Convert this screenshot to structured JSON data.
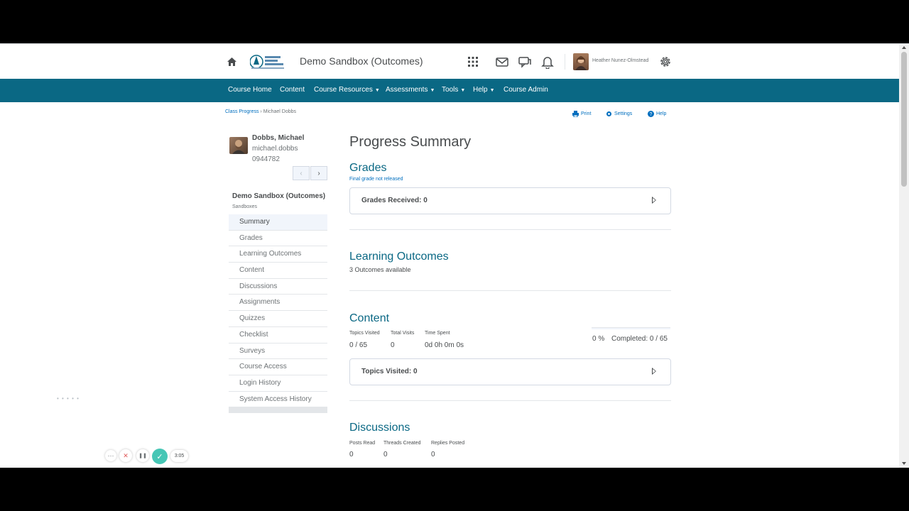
{
  "header": {
    "course_title": "Demo Sandbox (Outcomes)",
    "user_name": "Heather Nunez-Olmstead",
    "icons": [
      "home-icon",
      "waffle-icon",
      "mail-icon",
      "chat-icon",
      "bell-icon",
      "gear-icon"
    ]
  },
  "nav": {
    "items": [
      {
        "label": "Course Home",
        "caret": false
      },
      {
        "label": "Content",
        "caret": false
      },
      {
        "label": "Course Resources",
        "caret": true
      },
      {
        "label": "Assessments",
        "caret": true
      },
      {
        "label": "Tools",
        "caret": true
      },
      {
        "label": "Help",
        "caret": true
      },
      {
        "label": "Course Admin",
        "caret": false
      }
    ]
  },
  "breadcrumb": {
    "parent": "Class Progress",
    "separator": "›",
    "current": "Michael Dobbs"
  },
  "actions": {
    "print": "Print",
    "settings": "Settings",
    "help": "Help"
  },
  "student": {
    "name": "Dobbs, Michael",
    "username": "michael.dobbs",
    "id": "0944782",
    "prev": "‹",
    "next": "›"
  },
  "sidebar": {
    "course": "Demo Sandbox (Outcomes)",
    "subtitle": "Sandboxes",
    "items": [
      {
        "label": "Summary"
      },
      {
        "label": "Grades"
      },
      {
        "label": "Learning Outcomes"
      },
      {
        "label": "Content"
      },
      {
        "label": "Discussions"
      },
      {
        "label": "Assignments"
      },
      {
        "label": "Quizzes"
      },
      {
        "label": "Checklist"
      },
      {
        "label": "Surveys"
      },
      {
        "label": "Course Access"
      },
      {
        "label": "Login History"
      },
      {
        "label": "System Access History"
      }
    ]
  },
  "main": {
    "title": "Progress Summary",
    "grades": {
      "title": "Grades",
      "note": "Final grade not released",
      "panel": "Grades Received: 0"
    },
    "outcomes": {
      "title": "Learning Outcomes",
      "text": "3 Outcomes available"
    },
    "content": {
      "title": "Content",
      "topics_visited_label": "Topics Visited",
      "topics_visited_value": "0 / 65",
      "total_visits_label": "Total Visits",
      "total_visits_value": "0",
      "time_spent_label": "Time Spent",
      "time_spent_value": "0d 0h 0m 0s",
      "percent": "0 %",
      "completed_label": "Completed:",
      "completed_value": "0 / 65",
      "progress_fraction": 0,
      "panel": "Topics Visited: 0"
    },
    "discussions": {
      "title": "Discussions",
      "posts_read_label": "Posts Read",
      "posts_read_value": "0",
      "threads_label": "Threads Created",
      "threads_value": "0",
      "replies_label": "Replies Posted",
      "replies_value": "0"
    }
  },
  "player": {
    "dots": "• • • • •",
    "more": "···",
    "close": "✕",
    "pause": "❚❚",
    "check": "✓",
    "time": "3:05"
  },
  "colors": {
    "navbar": "#0a6884",
    "link": "#006fbf",
    "accent_check": "#46c6b5"
  }
}
